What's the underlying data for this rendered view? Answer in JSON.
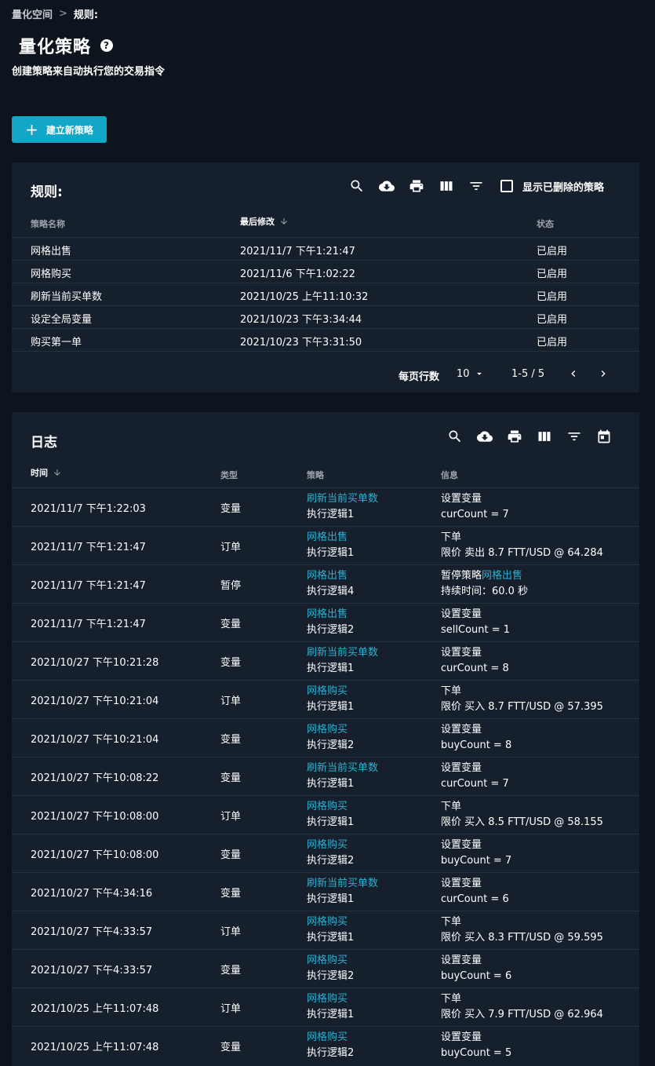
{
  "breadcrumb": {
    "root": "量化空间",
    "sep": ">",
    "current": "规则:"
  },
  "page": {
    "title": "量化策略",
    "help": "?",
    "subtitle": "创建策略来自动执行您的交易指令",
    "create_button": "建立新策略"
  },
  "rules": {
    "title": "规则:",
    "toolbar_icons": [
      "search-icon",
      "download-icon",
      "print-icon",
      "columns-icon",
      "filter-icon"
    ],
    "show_deleted_label": "显示已删除的策略",
    "columns": {
      "name": "策略名称",
      "modified": "最后修改",
      "status": "状态"
    },
    "rows": [
      {
        "name": "网格出售",
        "modified": "2021/11/7 下午1:21:47",
        "status": "已启用"
      },
      {
        "name": "网格购买",
        "modified": "2021/11/6 下午1:02:22",
        "status": "已启用"
      },
      {
        "name": "刷新当前买单数",
        "modified": "2021/10/25 上午11:10:32",
        "status": "已启用"
      },
      {
        "name": "设定全局变量",
        "modified": "2021/10/23 下午3:34:44",
        "status": "已启用"
      },
      {
        "name": "购买第一单",
        "modified": "2021/10/23 下午3:31:50",
        "status": "已启用"
      }
    ],
    "pager": {
      "rows_label": "每页行数",
      "rows_value": "10",
      "range": "1-5 / 5"
    }
  },
  "logs": {
    "title": "日志",
    "toolbar_icons": [
      "search-icon",
      "download-icon",
      "print-icon",
      "columns-icon",
      "filter-icon",
      "calendar-icon"
    ],
    "columns": {
      "time": "时间",
      "type": "类型",
      "strategy": "策略",
      "info": "信息"
    },
    "rows": [
      {
        "time": "2021/11/7 下午1:22:03",
        "type": "变量",
        "strategy": "刷新当前买单数",
        "logic": "执行逻辑1",
        "info1": "设置变量",
        "info2": "curCount = 7"
      },
      {
        "time": "2021/11/7 下午1:21:47",
        "type": "订单",
        "strategy": "网格出售",
        "logic": "执行逻辑1",
        "info1": "下单",
        "info2": "限价 卖出 8.7 FTT/USD @ 64.284"
      },
      {
        "time": "2021/11/7 下午1:21:47",
        "type": "暂停",
        "strategy": "网格出售",
        "logic": "执行逻辑4",
        "info1": "暂停策略",
        "info1_link": "网格出售",
        "info2": "持续时间：60.0 秒"
      },
      {
        "time": "2021/11/7 下午1:21:47",
        "type": "变量",
        "strategy": "网格出售",
        "logic": "执行逻辑2",
        "info1": "设置变量",
        "info2": "sellCount = 1"
      },
      {
        "time": "2021/10/27 下午10:21:28",
        "type": "变量",
        "strategy": "刷新当前买单数",
        "logic": "执行逻辑1",
        "info1": "设置变量",
        "info2": "curCount = 8"
      },
      {
        "time": "2021/10/27 下午10:21:04",
        "type": "订单",
        "strategy": "网格购买",
        "logic": "执行逻辑1",
        "info1": "下单",
        "info2": "限价 买入 8.7 FTT/USD @ 57.395"
      },
      {
        "time": "2021/10/27 下午10:21:04",
        "type": "变量",
        "strategy": "网格购买",
        "logic": "执行逻辑2",
        "info1": "设置变量",
        "info2": "buyCount = 8"
      },
      {
        "time": "2021/10/27 下午10:08:22",
        "type": "变量",
        "strategy": "刷新当前买单数",
        "logic": "执行逻辑1",
        "info1": "设置变量",
        "info2": "curCount = 7"
      },
      {
        "time": "2021/10/27 下午10:08:00",
        "type": "订单",
        "strategy": "网格购买",
        "logic": "执行逻辑1",
        "info1": "下单",
        "info2": "限价 买入 8.5 FTT/USD @ 58.155"
      },
      {
        "time": "2021/10/27 下午10:08:00",
        "type": "变量",
        "strategy": "网格购买",
        "logic": "执行逻辑2",
        "info1": "设置变量",
        "info2": "buyCount = 7"
      },
      {
        "time": "2021/10/27 下午4:34:16",
        "type": "变量",
        "strategy": "刷新当前买单数",
        "logic": "执行逻辑1",
        "info1": "设置变量",
        "info2": "curCount = 6"
      },
      {
        "time": "2021/10/27 下午4:33:57",
        "type": "订单",
        "strategy": "网格购买",
        "logic": "执行逻辑1",
        "info1": "下单",
        "info2": "限价 买入 8.3 FTT/USD @ 59.595"
      },
      {
        "time": "2021/10/27 下午4:33:57",
        "type": "变量",
        "strategy": "网格购买",
        "logic": "执行逻辑2",
        "info1": "设置变量",
        "info2": "buyCount = 6"
      },
      {
        "time": "2021/10/25 上午11:07:48",
        "type": "订单",
        "strategy": "网格购买",
        "logic": "执行逻辑1",
        "info1": "下单",
        "info2": "限价 买入 7.9 FTT/USD @ 62.964"
      },
      {
        "time": "2021/10/25 上午11:07:48",
        "type": "变量",
        "strategy": "网格购买",
        "logic": "执行逻辑2",
        "info1": "设置变量",
        "info2": "buyCount = 5"
      }
    ]
  },
  "colors": {
    "background": "#0e141d",
    "panel": "#161f2c",
    "accent": "#12a6c7",
    "link": "#2eb0d1",
    "muted": "#9ca3ad"
  }
}
